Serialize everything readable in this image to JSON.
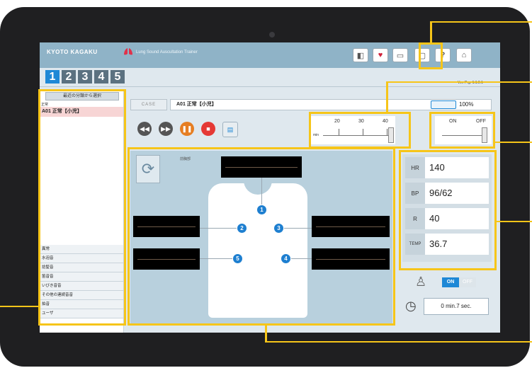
{
  "header": {
    "brand": "KYOTO KAGAKU",
    "subtitle": "Lung Sound Auscultation Trainer"
  },
  "toolbar": {
    "icons": [
      "speaker-icon",
      "lungs-icon",
      "monitor-icon",
      "book-icon",
      "help-icon",
      "home-icon"
    ],
    "help_label": "?"
  },
  "tabs": [
    "1",
    "2",
    "3",
    "4",
    "5"
  ],
  "version": "Ver. Prg: 1.1.0.1",
  "sidebar": {
    "header": "最近の分類から選択",
    "small_label": "正常",
    "selected_case": "A01 正常【小児】",
    "categories": [
      "異常",
      "水泡音",
      "捻髪音",
      "笛音音",
      "いびき音音",
      "その他の連続音音",
      "拍音",
      "ユーザ"
    ]
  },
  "case": {
    "label": "CASE",
    "value": "A01 正常【小児】"
  },
  "battery": {
    "percent": "100%"
  },
  "volume": {
    "ticks": [
      "20",
      "30",
      "40"
    ],
    "min_label": "min"
  },
  "switch": {
    "on": "ON",
    "off": "OFF"
  },
  "body": {
    "corner_label": "前胸部",
    "points": [
      "1",
      "2",
      "3",
      "4",
      "5"
    ]
  },
  "vitals": [
    {
      "label": "HR",
      "value": "140"
    },
    {
      "label": "BP",
      "value": "96/62"
    },
    {
      "label": "R",
      "value": "40"
    },
    {
      "label": "TEMP",
      "value": "36.7"
    }
  ],
  "toggle": {
    "on": "ON",
    "off": "OFF"
  },
  "timer": {
    "value": "0 min.7 sec."
  },
  "colors": {
    "accent": "#1e88d6",
    "highlight": "#f6c519",
    "topbar": "#8fb3c7"
  }
}
